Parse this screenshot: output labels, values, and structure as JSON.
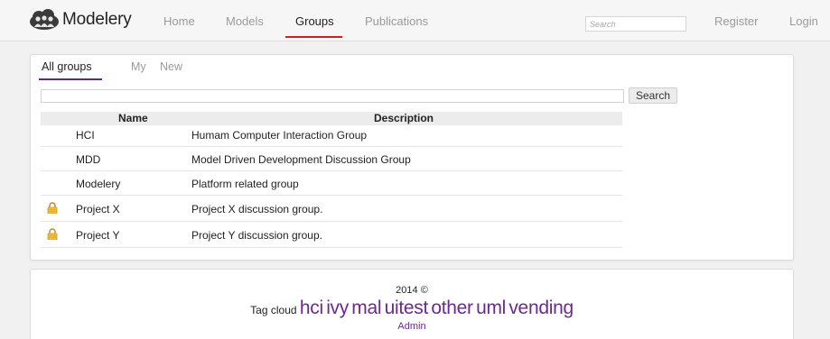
{
  "navbar": {
    "brand": "Modelery",
    "links": {
      "home": "Home",
      "models": "Models",
      "groups": "Groups",
      "publications": "Publications",
      "register": "Register",
      "login": "Login"
    },
    "active": "groups",
    "search_placeholder": "Search",
    "accent_color": "#c4232b"
  },
  "tabs": {
    "items": [
      "All groups",
      "My",
      "New"
    ],
    "active": "All groups",
    "accent_color": "#5f2a82"
  },
  "group_search": {
    "value": "",
    "button_label": "Search"
  },
  "table": {
    "headers": {
      "name": "Name",
      "description": "Description"
    },
    "rows": [
      {
        "locked": false,
        "name": "HCI",
        "description": "Humam Computer Interaction Group"
      },
      {
        "locked": false,
        "name": "MDD",
        "description": "Model Driven Development Discussion Group"
      },
      {
        "locked": false,
        "name": "Modelery",
        "description": "Platform related group"
      },
      {
        "locked": true,
        "name": "Project X",
        "description": "Project X discussion group."
      },
      {
        "locked": true,
        "name": "Project Y",
        "description": "Project Y discussion group."
      }
    ]
  },
  "footer": {
    "copyright": "2014 ©",
    "tag_cloud_label": "Tag cloud",
    "tags": [
      "hci",
      "ivy",
      "mal",
      "ui",
      "test",
      "other",
      "uml",
      "vending"
    ],
    "admin_label": "Admin",
    "tag_color": "#6a2a8f"
  }
}
